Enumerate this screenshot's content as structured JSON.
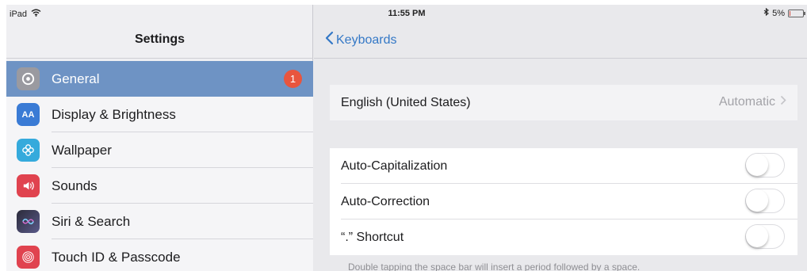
{
  "status_bar": {
    "device": "iPad",
    "time": "11:55 PM",
    "battery": "5%",
    "battery_level": 0.05,
    "icons": [
      "wifi-icon",
      "bluetooth-icon",
      "battery-icon"
    ]
  },
  "sidebar": {
    "title": "Settings",
    "items": [
      {
        "label": "General",
        "icon": "gear-icon",
        "color": "#8e8e93",
        "selected": true,
        "badge": "1"
      },
      {
        "label": "Display & Brightness",
        "icon": "display-brightness-icon",
        "color": "#3a7bd5",
        "selected": false
      },
      {
        "label": "Wallpaper",
        "icon": "wallpaper-icon",
        "color": "#35aadc",
        "selected": false
      },
      {
        "label": "Sounds",
        "icon": "speaker-icon",
        "color": "#e0434f",
        "selected": false
      },
      {
        "label": "Siri & Search",
        "icon": "siri-icon",
        "color": "#2b2b3a",
        "selected": false
      },
      {
        "label": "Touch ID & Passcode",
        "icon": "fingerprint-icon",
        "color": "#e0434f",
        "selected": false
      }
    ]
  },
  "detail": {
    "back_label": "Keyboards",
    "language": {
      "label": "English (United States)",
      "value": "Automatic"
    },
    "toggles": [
      {
        "label": "Auto-Capitalization",
        "on": false
      },
      {
        "label": "Auto-Correction",
        "on": false
      },
      {
        "label": "“.” Shortcut",
        "on": false
      }
    ],
    "footnote": "Double tapping the space bar will insert a period followed by a space."
  },
  "colors": {
    "accent": "#3478c6",
    "selected_row": "#6e93c4",
    "badge": "#e8553e",
    "background": "#e9e9ec"
  }
}
